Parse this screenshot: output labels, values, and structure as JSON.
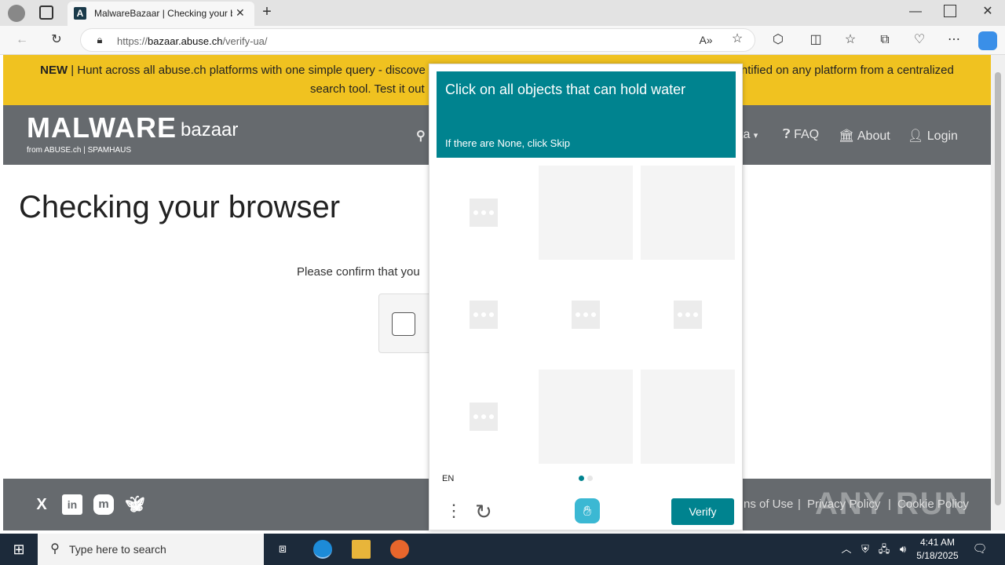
{
  "browser": {
    "tab_title": "MalwareBazaar | Checking your b",
    "url_prefix": "https://",
    "url_host": "bazaar.abuse.ch",
    "url_path": "/verify-ua/"
  },
  "banner": {
    "new_label": "NEW",
    "text_left": " | Hunt across all abuse.ch platforms with one simple query - discove",
    "text_right": "ntified on any platform from a centralized",
    "line2_left": "search tool. Test it out"
  },
  "nav": {
    "logo_main": "MALWARE",
    "logo_sub": "bazaar",
    "logo_from": "from ABUSE.ch | SPAMHAUS",
    "items": [
      "ta",
      "FAQ",
      "About",
      "Login"
    ]
  },
  "main": {
    "title": "Checking your browser",
    "confirm": "Please confirm that you"
  },
  "footer": {
    "links": [
      "ns of Use",
      "Privacy Policy",
      "Cookie Policy"
    ],
    "watermark": "ANY RUN"
  },
  "captcha": {
    "prompt": "Click on all objects that can hold water",
    "hint": "If there are None, click Skip",
    "lang": "EN",
    "verify_label": "Verify",
    "accent": "#00838f"
  },
  "taskbar": {
    "search_placeholder": "Type here to search",
    "time": "4:41 AM",
    "date": "5/18/2025"
  }
}
